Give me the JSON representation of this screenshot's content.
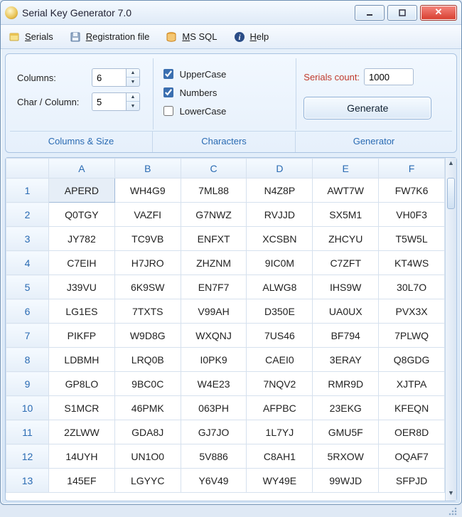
{
  "window": {
    "title": "Serial Key Generator 7.0"
  },
  "menubar": {
    "serials": "Serials",
    "regfile": "Registration file",
    "mssql": "MS SQL",
    "help": "Help"
  },
  "config": {
    "columns_label": "Columns:",
    "columns_value": "6",
    "charcol_label": "Char / Column:",
    "charcol_value": "5",
    "checkbox_upper": "UpperCase",
    "checkbox_upper_checked": true,
    "checkbox_numbers": "Numbers",
    "checkbox_numbers_checked": true,
    "checkbox_lower": "LowerCase",
    "checkbox_lower_checked": false,
    "serials_count_label": "Serials count:",
    "serials_count_value": "1000",
    "generate_label": "Generate",
    "section_columns": "Columns & Size",
    "section_chars": "Characters",
    "section_generator": "Generator"
  },
  "grid": {
    "headers": [
      "A",
      "B",
      "C",
      "D",
      "E",
      "F"
    ],
    "row_headers": [
      "1",
      "2",
      "3",
      "4",
      "5",
      "6",
      "7",
      "8",
      "9",
      "10",
      "11",
      "12",
      "13"
    ],
    "rows": [
      [
        "APERD",
        "WH4G9",
        "7ML88",
        "N4Z8P",
        "AWT7W",
        "FW7K6"
      ],
      [
        "Q0TGY",
        "VAZFI",
        "G7NWZ",
        "RVJJD",
        "SX5M1",
        "VH0F3"
      ],
      [
        "JY782",
        "TC9VB",
        "ENFXT",
        "XCSBN",
        "ZHCYU",
        "T5W5L"
      ],
      [
        "C7EIH",
        "H7JRO",
        "ZHZNM",
        "9IC0M",
        "C7ZFT",
        "KT4WS"
      ],
      [
        "J39VU",
        "6K9SW",
        "EN7F7",
        "ALWG8",
        "IHS9W",
        "30L7O"
      ],
      [
        "LG1ES",
        "7TXTS",
        "V99AH",
        "D350E",
        "UA0UX",
        "PVX3X"
      ],
      [
        "PIKFP",
        "W9D8G",
        "WXQNJ",
        "7US46",
        "BF794",
        "7PLWQ"
      ],
      [
        "LDBMH",
        "LRQ0B",
        "I0PK9",
        "CAEI0",
        "3ERAY",
        "Q8GDG"
      ],
      [
        "GP8LO",
        "9BC0C",
        "W4E23",
        "7NQV2",
        "RMR9D",
        "XJTPA"
      ],
      [
        "S1MCR",
        "46PMK",
        "063PH",
        "AFPBC",
        "23EKG",
        "KFEQN"
      ],
      [
        "2ZLWW",
        "GDA8J",
        "GJ7JO",
        "1L7YJ",
        "GMU5F",
        "OER8D"
      ],
      [
        "14UYH",
        "UN1O0",
        "5V886",
        "C8AH1",
        "5RXOW",
        "OQAF7"
      ],
      [
        "145EF",
        "LGYYC",
        "Y6V49",
        "WY49E",
        "99WJD",
        "SFPJD"
      ]
    ],
    "selected": {
      "row": 0,
      "col": 0
    }
  }
}
